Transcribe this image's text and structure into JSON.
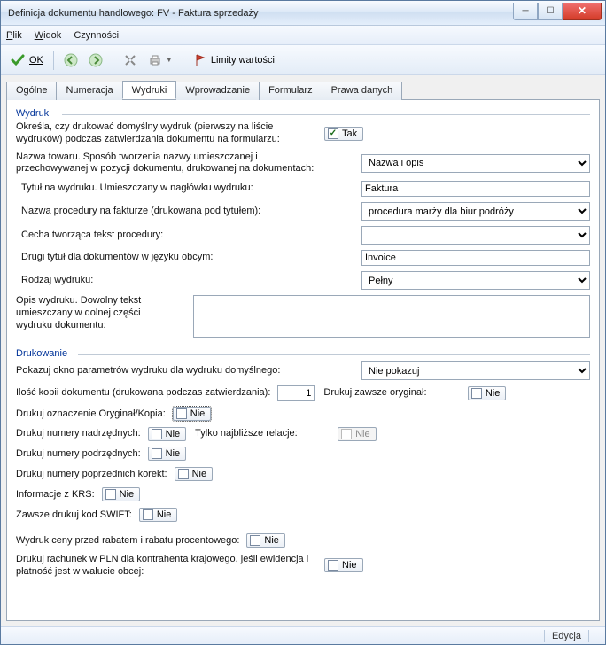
{
  "window": {
    "title": "Definicja dokumentu handlowego: FV - Faktura sprzedaży"
  },
  "menu": {
    "plik": "Plik",
    "widok": "Widok",
    "czynnosci": "Czynności"
  },
  "toolbar": {
    "ok": "OK",
    "limity": "Limity wartości"
  },
  "tabs": {
    "ogolne": "Ogólne",
    "numeracja": "Numeracja",
    "wydruki": "Wydruki",
    "wprowadzanie": "Wprowadzanie",
    "formularz": "Formularz",
    "prawa": "Prawa danych"
  },
  "groups": {
    "wydruk": "Wydruk",
    "drukowanie": "Drukowanie"
  },
  "labels": {
    "okresla": "Określa, czy drukować domyślny wydruk (pierwszy na liście wydruków) podczas zatwierdzania dokumentu na formularzu:",
    "nazwa_towaru": "Nazwa towaru. Sposób tworzenia nazwy umieszczanej i przechowywanej w pozycji dokumentu, drukowanej na dokumentach:",
    "tytul": "Tytuł na wydruku. Umieszczany w nagłówku wydruku:",
    "nazwa_proc": "Nazwa procedury na fakturze (drukowana pod tytułem):",
    "cecha": "Cecha tworząca tekst procedury:",
    "drugi_tytul": "Drugi tytuł dla dokumentów w języku obcym:",
    "rodzaj": "Rodzaj wydruku:",
    "opis": "Opis wydruku. Dowolny tekst umieszczany w dolnej części wydruku dokumentu:",
    "pokazuj": "Pokazuj okno parametrów wydruku dla wydruku domyślnego:",
    "ilosc": "Ilość kopii dokumentu (drukowana podczas zatwierdzania):",
    "drukuj_oryg": "Drukuj zawsze oryginał:",
    "drukuj_ozn": "Drukuj oznaczenie Oryginał/Kopia:",
    "drukuj_nadrz": "Drukuj numery nadrzędnych:",
    "tylko_najb": "Tylko najbliższe relacje:",
    "drukuj_podrz": "Drukuj numery podrzędnych:",
    "drukuj_korekt": "Drukuj numery poprzednich korekt:",
    "info_krs": "Informacje z KRS:",
    "zawsze_swift": "Zawsze drukuj kod SWIFT:",
    "wydruk_ceny": "Wydruk ceny przed rabatem i rabatu procentowego:",
    "drukuj_rachunek": "Drukuj rachunek w PLN dla kontrahenta krajowego, jeśli ewidencja i płatność jest w walucie obcej:"
  },
  "values": {
    "tak": "Tak",
    "nie": "Nie",
    "nazwa_opis": "Nazwa i opis",
    "faktura": "Faktura",
    "procedura": "procedura marży dla biur podróży",
    "cecha_sel": "",
    "invoice": "Invoice",
    "pelny": "Pełny",
    "opis_text": "",
    "nie_pokazuj": "Nie pokazuj",
    "ilosc_val": "1"
  },
  "status": {
    "edycja": "Edycja"
  }
}
